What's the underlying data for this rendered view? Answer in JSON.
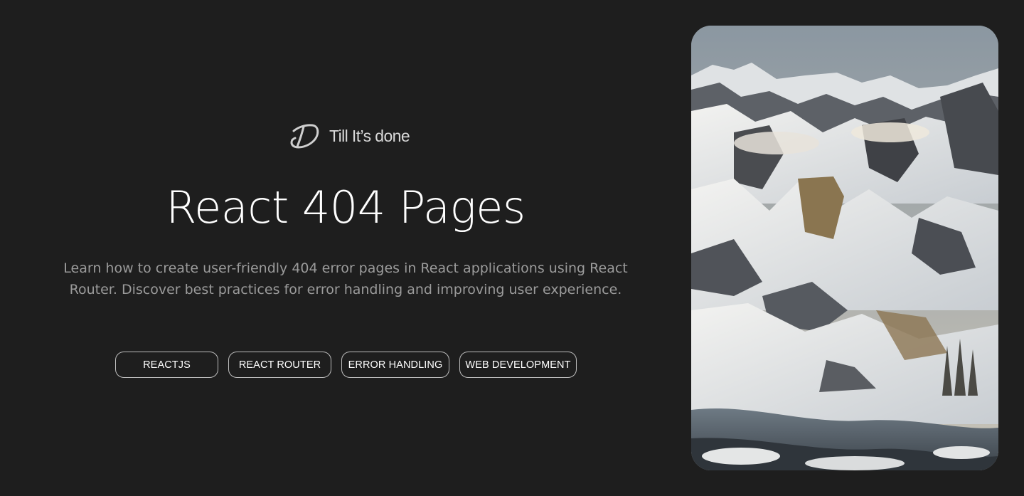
{
  "brand": {
    "name": "Till It’s done",
    "logo_icon": "signature-logo-icon"
  },
  "hero": {
    "title": "React 404 Pages",
    "description": "Learn how to create user-friendly 404 error pages in React applications using React Router. Discover best practices for error handling and improving user experience."
  },
  "tags": [
    {
      "label": "REACTJS"
    },
    {
      "label": "REACT ROUTER"
    },
    {
      "label": "ERROR HANDLING"
    },
    {
      "label": "WEB DEVELOPMENT"
    }
  ],
  "image": {
    "subject": "snowy-mountain-landscape-image"
  },
  "colors": {
    "background": "#1e1e1e",
    "text_primary": "#ffffff",
    "text_muted": "#9b9b9b",
    "tag_border": "#bdbdbd"
  }
}
